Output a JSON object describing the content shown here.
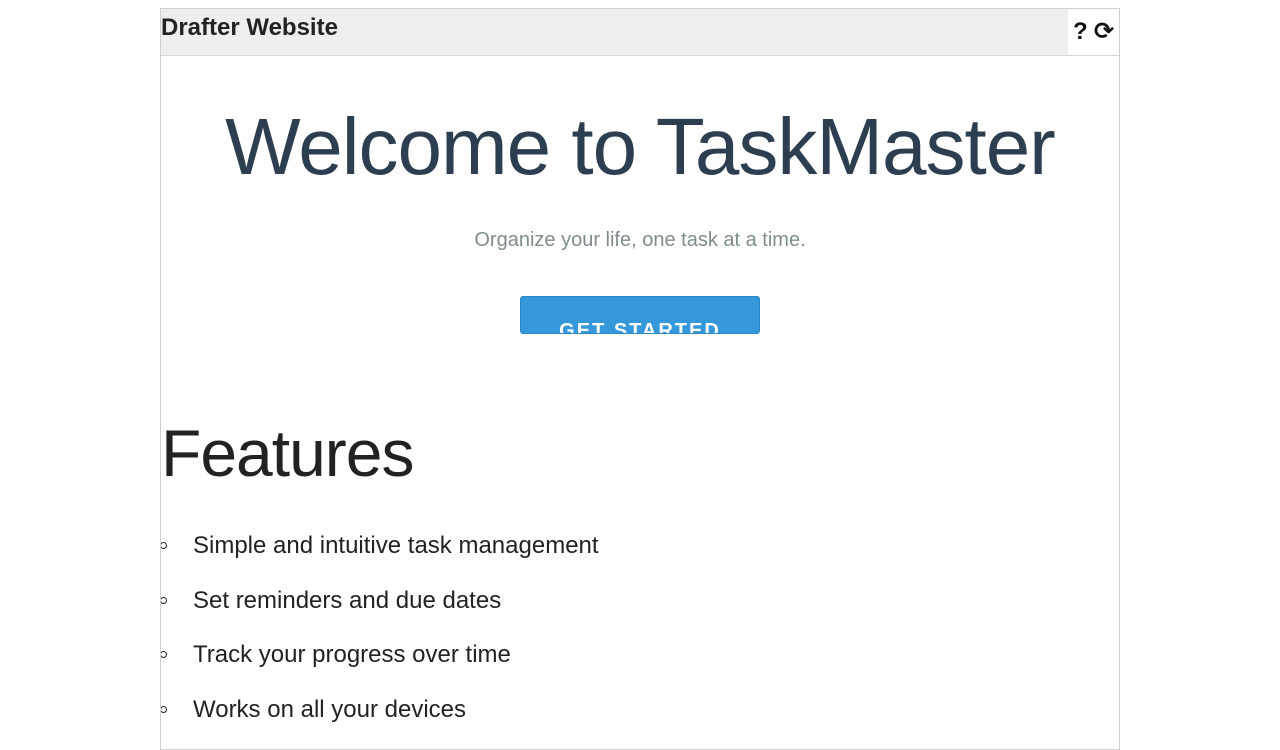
{
  "header": {
    "site_title": "Drafter Website",
    "help_label": "?",
    "refresh_label": "⟳"
  },
  "hero": {
    "title": "Welcome to TaskMaster",
    "subtitle": "Organize your life, one task at a time.",
    "cta_label": "GET STARTED"
  },
  "features": {
    "heading": "Features",
    "items": [
      "Simple and intuitive task management",
      "Set reminders and due dates",
      "Track your progress over time",
      "Works on all your devices"
    ]
  },
  "colors": {
    "heading": "#2c3e50",
    "subtitle": "#7f8c8d",
    "accent": "#3498db",
    "topbar": "#eeeeee"
  }
}
